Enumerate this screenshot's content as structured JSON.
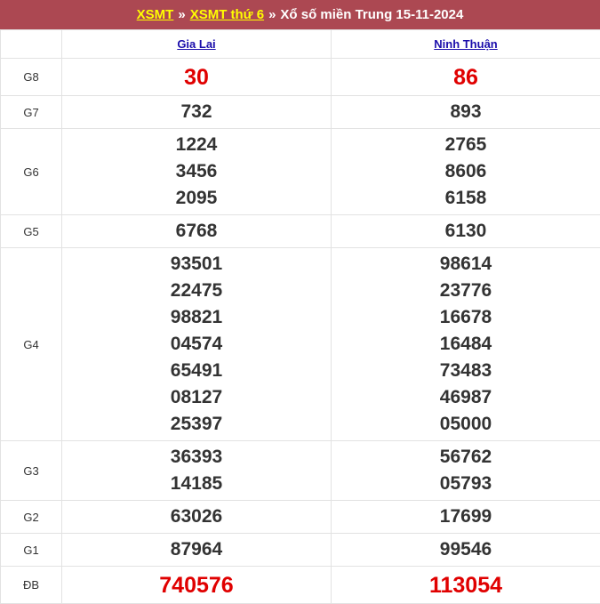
{
  "header": {
    "link1": "XSMT",
    "sep1": "»",
    "link2": "XSMT thứ 6",
    "sep2": "»",
    "title": "Xổ số miền Trung 15-11-2024"
  },
  "provinces": [
    "Gia Lai",
    "Ninh Thuận"
  ],
  "prizes": [
    {
      "label": "G8",
      "values": [
        [
          "30"
        ],
        [
          "86"
        ]
      ]
    },
    {
      "label": "G7",
      "values": [
        [
          "732"
        ],
        [
          "893"
        ]
      ]
    },
    {
      "label": "G6",
      "values": [
        [
          "1224",
          "3456",
          "2095"
        ],
        [
          "2765",
          "8606",
          "6158"
        ]
      ]
    },
    {
      "label": "G5",
      "values": [
        [
          "6768"
        ],
        [
          "6130"
        ]
      ]
    },
    {
      "label": "G4",
      "values": [
        [
          "93501",
          "22475",
          "98821",
          "04574",
          "65491",
          "08127",
          "25397"
        ],
        [
          "98614",
          "23776",
          "16678",
          "16484",
          "73483",
          "46987",
          "05000"
        ]
      ]
    },
    {
      "label": "G3",
      "values": [
        [
          "36393",
          "14185"
        ],
        [
          "56762",
          "05793"
        ]
      ]
    },
    {
      "label": "G2",
      "values": [
        [
          "63026"
        ],
        [
          "17699"
        ]
      ]
    },
    {
      "label": "G1",
      "values": [
        [
          "87964"
        ],
        [
          "99546"
        ]
      ]
    },
    {
      "label": "ĐB",
      "values": [
        [
          "740576"
        ],
        [
          "113054"
        ]
      ]
    }
  ],
  "colors": {
    "header_bg": "#ac4852",
    "header_link": "#ffff00",
    "highlight": "#e00000",
    "province_link": "#1a0dab"
  }
}
